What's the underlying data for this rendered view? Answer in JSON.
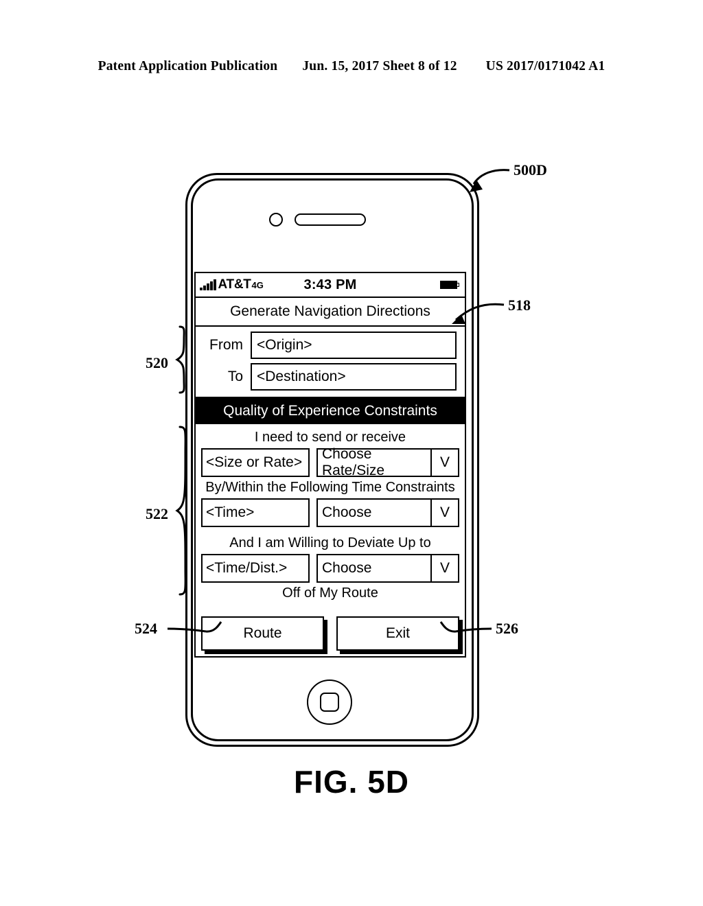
{
  "publication_header": {
    "title": "Patent Application Publication",
    "date_sheet": "Jun. 15, 2017  Sheet 8 of 12",
    "patent_number": "US 2017/0171042 A1"
  },
  "figure": {
    "label": "FIG. 5D",
    "device_ref": "500D"
  },
  "annotations": {
    "device": "500D",
    "title_bar": "518",
    "endpoints_group": "520",
    "constraints_group": "522",
    "route_button": "524",
    "exit_button": "526"
  },
  "phone": {
    "status_bar": {
      "carrier": "AT&T",
      "network": "4G",
      "time": "3:43 PM",
      "signal_icon": "signal-bars-icon",
      "battery_icon": "battery-full-icon"
    },
    "app_title": "Generate Navigation Directions",
    "endpoints": [
      {
        "label": "From",
        "value": "<Origin>"
      },
      {
        "label": "To",
        "value": "<Destination>"
      }
    ],
    "section_header": "Quality of Experience Constraints",
    "constraints": [
      {
        "caption": "I need to send or receive",
        "value": "<Size or Rate>",
        "select": "Choose Rate/Size",
        "arrow": "V"
      },
      {
        "caption": "By/Within the Following Time Constraints",
        "value": "<Time>",
        "select": "Choose",
        "arrow": "V"
      },
      {
        "caption": "And I am Willing to Deviate Up to",
        "value": "<Time/Dist.>",
        "select": "Choose",
        "arrow": "V"
      }
    ],
    "trailing_caption": "Off of My Route",
    "buttons": {
      "route": "Route",
      "exit": "Exit"
    }
  },
  "colors": {
    "ink": "#000000",
    "paper": "#ffffff",
    "section_header_bg": "#000000",
    "section_header_fg": "#ffffff"
  }
}
